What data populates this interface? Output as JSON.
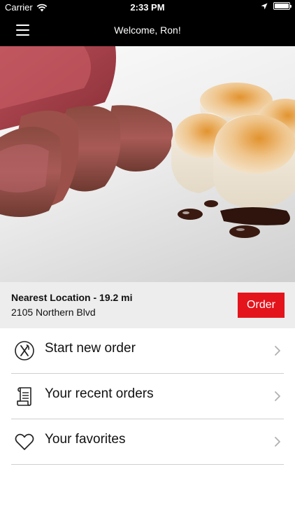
{
  "status": {
    "carrier": "Carrier",
    "time": "2:33 PM"
  },
  "nav": {
    "title": "Welcome, Ron!"
  },
  "location": {
    "title": "Nearest Location - 19.2 mi",
    "address": "2105 Northern Blvd",
    "order_label": "Order"
  },
  "menu": [
    {
      "label": "Start new order",
      "icon": "utensils-icon"
    },
    {
      "label": "Your recent orders",
      "icon": "receipt-icon"
    },
    {
      "label": "Your favorites",
      "icon": "heart-icon"
    }
  ],
  "colors": {
    "accent": "#e3141c",
    "nav_background": "#000000",
    "location_background": "#ededed"
  }
}
